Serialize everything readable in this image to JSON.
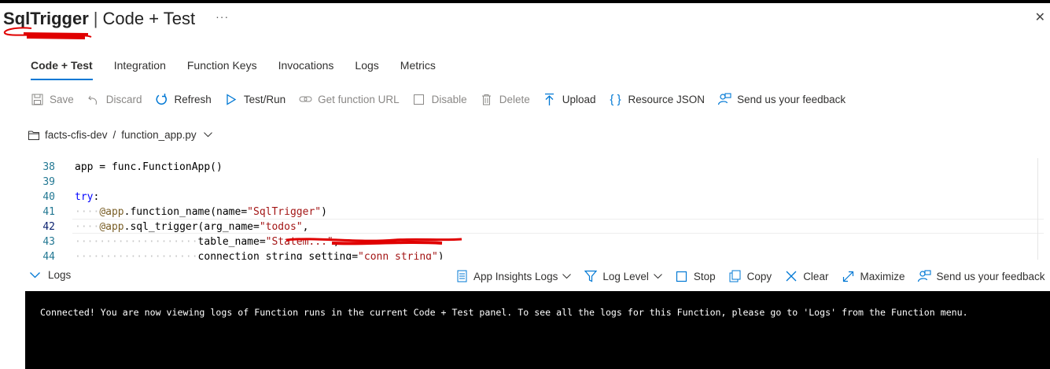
{
  "header": {
    "title": "SqlTrigger",
    "separator": "|",
    "subtitle": "Code + Test",
    "more_glyph": "···",
    "close_glyph": "✕"
  },
  "tabs": [
    {
      "label": "Code + Test",
      "active": true
    },
    {
      "label": "Integration",
      "active": false
    },
    {
      "label": "Function Keys",
      "active": false
    },
    {
      "label": "Invocations",
      "active": false
    },
    {
      "label": "Logs",
      "active": false
    },
    {
      "label": "Metrics",
      "active": false
    }
  ],
  "toolbar": {
    "save": "Save",
    "discard": "Discard",
    "refresh": "Refresh",
    "test_run": "Test/Run",
    "get_url": "Get function URL",
    "disable": "Disable",
    "delete": "Delete",
    "upload": "Upload",
    "resource_json": "Resource JSON",
    "feedback": "Send us your feedback"
  },
  "path": {
    "app": "facts-cfis-dev",
    "separator": "/",
    "file": "function_app.py"
  },
  "editor": {
    "lines": [
      {
        "num": "38",
        "tokens": [
          [
            "",
            "app = func.FunctionApp()"
          ]
        ]
      },
      {
        "num": "39",
        "tokens": []
      },
      {
        "num": "40",
        "tokens": [
          [
            "kw",
            "try"
          ],
          [
            "",
            ":"
          ]
        ]
      },
      {
        "num": "41",
        "tokens": [
          [
            "dec",
            "@app"
          ],
          [
            "",
            ".function_name(name="
          ],
          [
            "str",
            "\"SqlTrigger\""
          ],
          [
            "",
            ")"
          ]
        ]
      },
      {
        "num": "42",
        "tokens": [
          [
            "dec",
            "@app"
          ],
          [
            "",
            ".sql_trigger(arg_name="
          ],
          [
            "str",
            "\"todos\""
          ],
          [
            "",
            ","
          ]
        ]
      },
      {
        "num": "43",
        "tokens": [
          [
            "",
            "table_name="
          ],
          [
            "str",
            "\"Statem...\""
          ],
          [
            "",
            ","
          ]
        ]
      },
      {
        "num": "44",
        "tokens": [
          [
            "",
            "connection_string_setting="
          ],
          [
            "str",
            "\"conn_string\""
          ],
          [
            "",
            ")"
          ]
        ]
      }
    ]
  },
  "logs": {
    "toggle_label": "Logs",
    "app_insights": "App Insights Logs",
    "log_level": "Log Level",
    "stop": "Stop",
    "copy": "Copy",
    "clear": "Clear",
    "maximize": "Maximize",
    "feedback": "Send us your feedback",
    "console_message": "Connected! You are now viewing logs of Function runs in the current Code + Test panel. To see all the logs for this Function, please go to 'Logs' from the Function menu."
  },
  "colors": {
    "accent": "#0078d4",
    "redaction": "#e00000",
    "console_bg": "#000000"
  }
}
